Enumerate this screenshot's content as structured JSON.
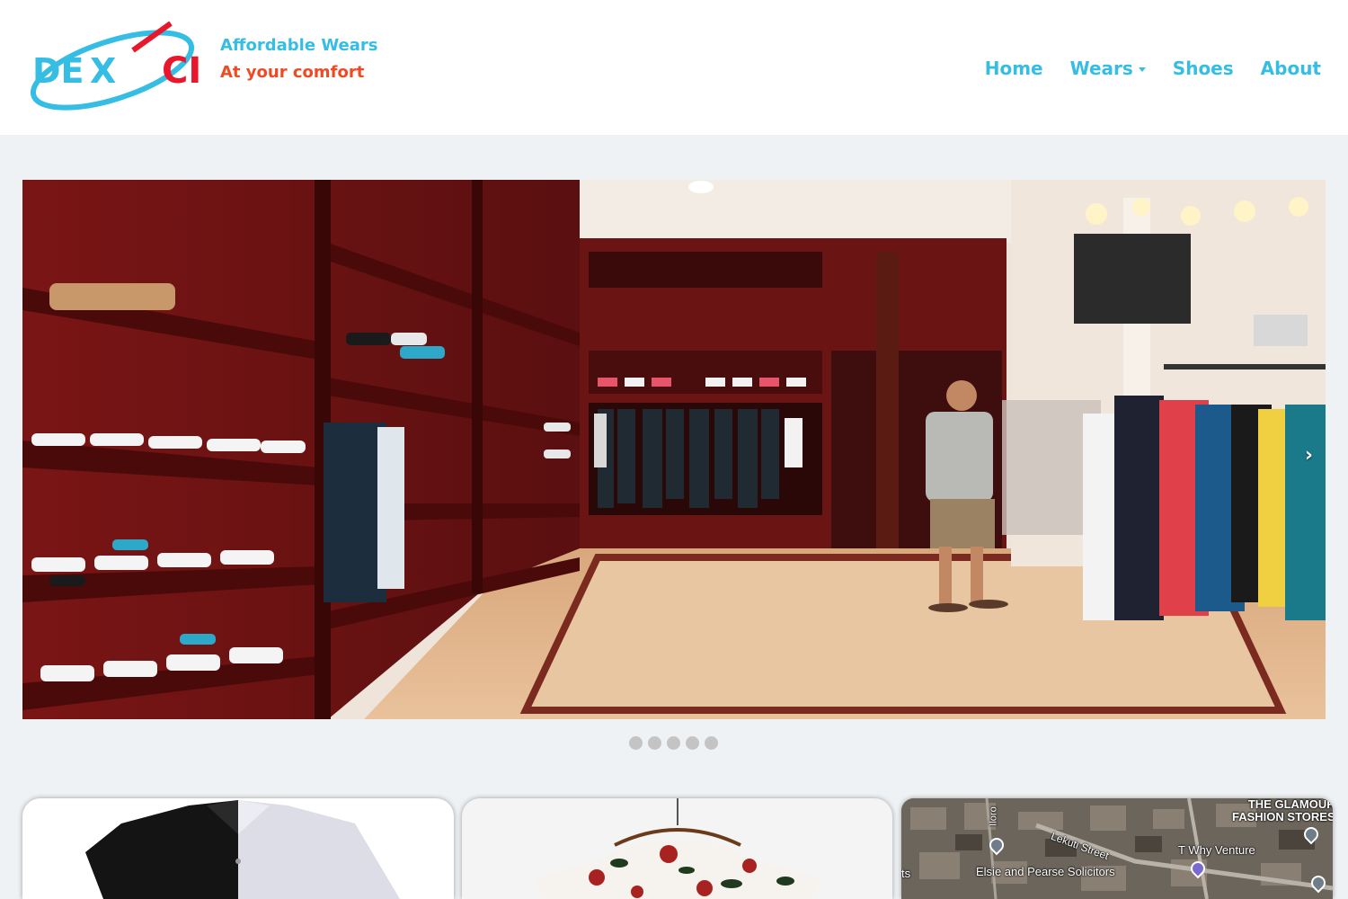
{
  "brand": {
    "logo_text": "DEXCI",
    "tagline_line1": "Affordable Wears",
    "tagline_line2": "At your comfort",
    "colors": {
      "cyan": "#35bde4",
      "red": "#e8172b",
      "orange": "#f04a24"
    }
  },
  "nav": {
    "items": [
      {
        "label": "Home"
      },
      {
        "label": "Wears",
        "has_dropdown": true
      },
      {
        "label": "Shoes"
      },
      {
        "label": "About"
      }
    ]
  },
  "carousel": {
    "slide_count": 5,
    "active_slide": 1,
    "next_icon": "chevron-right-icon"
  },
  "cards": [
    {
      "image": "shirt-black-white"
    },
    {
      "image": "floral-tshirt-on-hanger"
    },
    {
      "image": "satellite-map",
      "map_labels": {
        "store": "THE GLAMOUR\nFASHION STORES",
        "street": "Lekuti Street",
        "venture": "T Why Venture",
        "solicitors": "Elsie and Pearse Solicitors",
        "edge_left": "ts",
        "edge_vertical": "Iloro"
      }
    }
  ]
}
